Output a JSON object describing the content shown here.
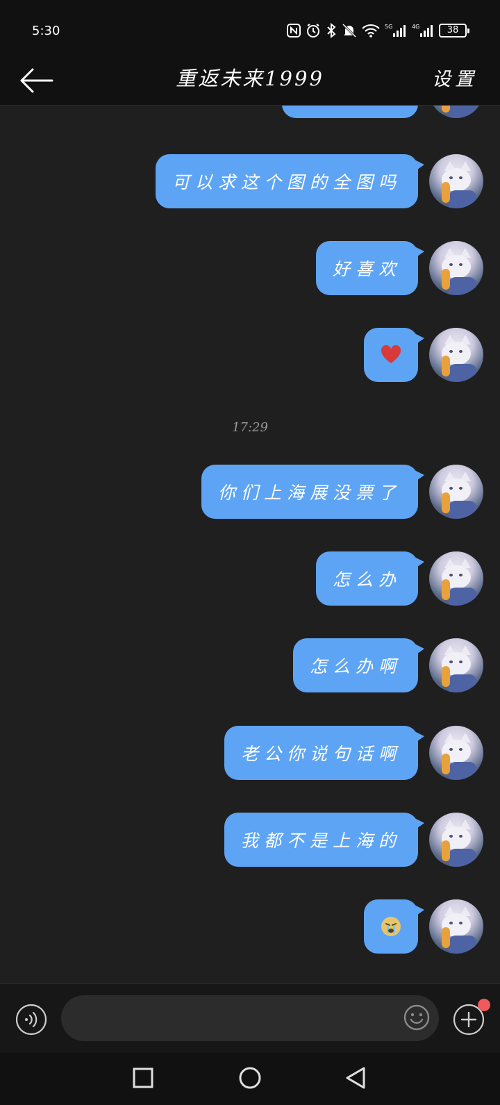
{
  "status_bar": {
    "time": "5:30",
    "battery": "38",
    "network_labels": [
      "5G",
      "4G"
    ]
  },
  "nav": {
    "title": "重返未来1999",
    "settings_label": "设置"
  },
  "chat": {
    "timestamp": "17:29",
    "bubble_color": "#5da4f5",
    "messages": [
      {
        "text": "",
        "type": "text"
      },
      {
        "text": "可以求这个图的全图吗",
        "type": "text"
      },
      {
        "text": "好喜欢",
        "type": "text"
      },
      {
        "text": "❤️",
        "type": "emoji"
      },
      {
        "text": "你们上海展没票了",
        "type": "text"
      },
      {
        "text": "怎么办",
        "type": "text"
      },
      {
        "text": "怎么办啊",
        "type": "text"
      },
      {
        "text": "老公你说句话啊",
        "type": "text"
      },
      {
        "text": "我都不是上海的",
        "type": "text"
      },
      {
        "text": "😭",
        "type": "emoji"
      }
    ]
  },
  "input_bar": {
    "placeholder": "",
    "voice_icon": "voice-icon",
    "emoji_icon": "emoji-icon",
    "plus_icon": "plus-icon",
    "notification_dot_color": "#f05a5a"
  },
  "system_nav": {
    "icons": [
      "recents-square-icon",
      "home-circle-icon",
      "back-triangle-icon"
    ]
  }
}
